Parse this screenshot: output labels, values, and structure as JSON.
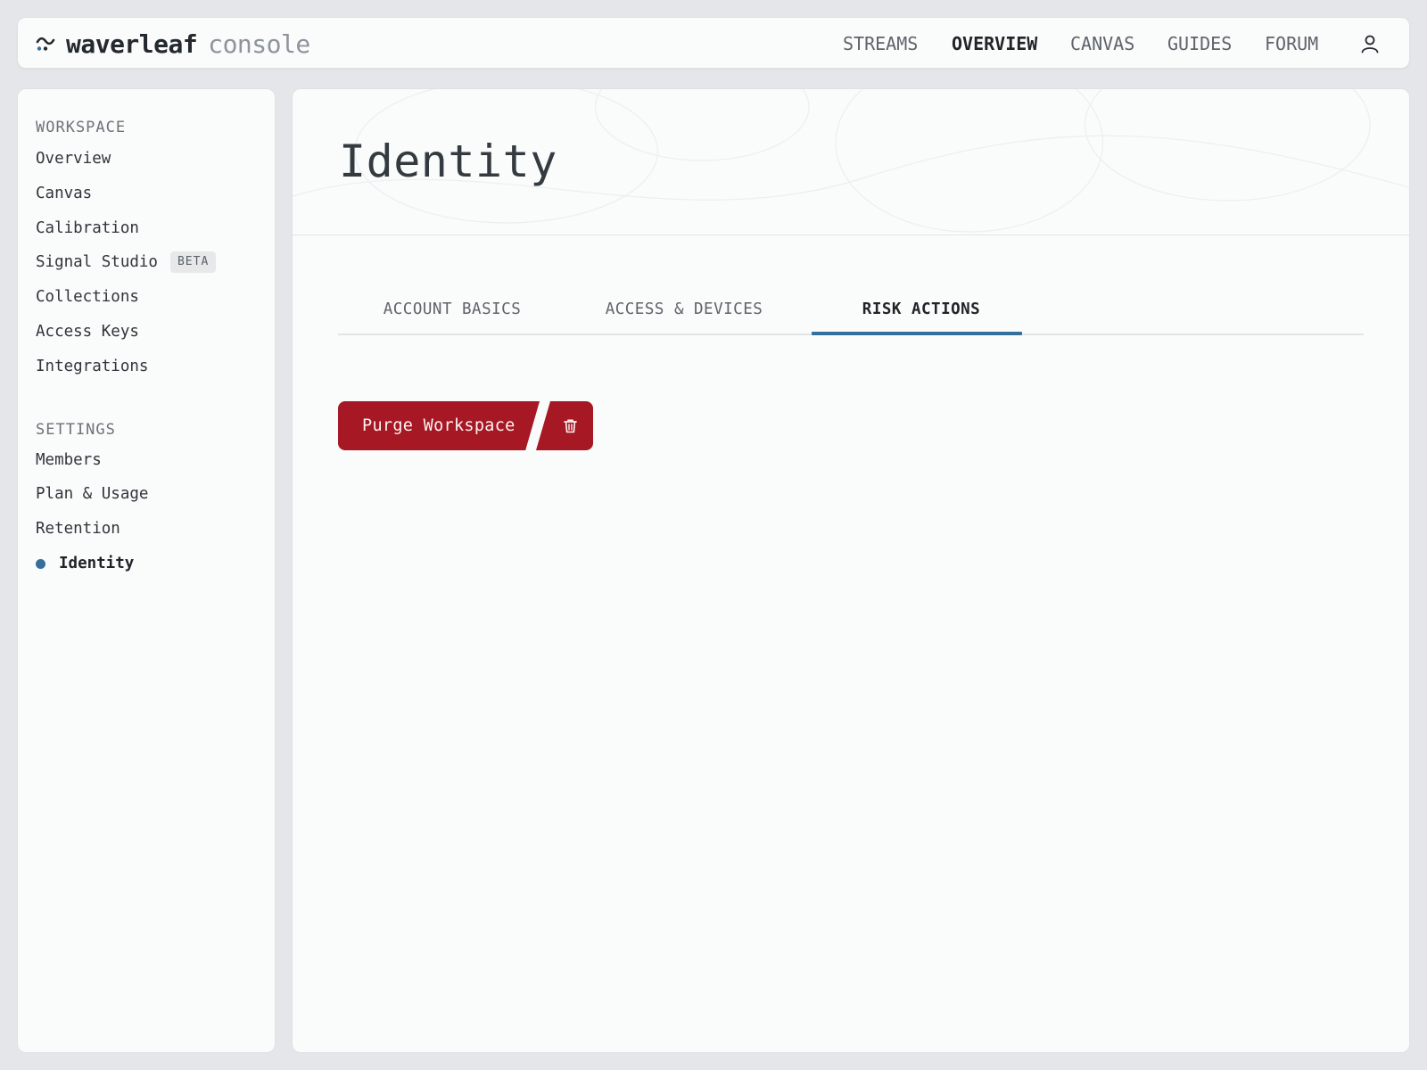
{
  "brand": {
    "name": "waverleaf",
    "sub": "console",
    "icon": "wave-logo-icon"
  },
  "topnav": {
    "items": [
      {
        "label": "STREAMS",
        "active": false
      },
      {
        "label": "OVERVIEW",
        "active": true
      },
      {
        "label": "CANVAS",
        "active": false
      },
      {
        "label": "GUIDES",
        "active": false
      },
      {
        "label": "FORUM",
        "active": false
      }
    ],
    "user_icon": "user-icon"
  },
  "sidebar": {
    "workspace_heading": "WORKSPACE",
    "workspace_items": [
      {
        "label": "Overview"
      },
      {
        "label": "Canvas"
      },
      {
        "label": "Calibration"
      },
      {
        "label": "Signal Studio",
        "badge": "BETA"
      },
      {
        "label": "Collections"
      },
      {
        "label": "Access Keys"
      },
      {
        "label": "Integrations"
      }
    ],
    "settings_heading": "SETTINGS",
    "settings_items": [
      {
        "label": "Members"
      },
      {
        "label": "Plan & Usage"
      },
      {
        "label": "Retention"
      },
      {
        "label": "Identity",
        "active": true
      }
    ]
  },
  "main": {
    "title": "Identity",
    "tabs": [
      {
        "label": "ACCOUNT BASICS",
        "active": false
      },
      {
        "label": "ACCESS & DEVICES",
        "active": false
      },
      {
        "label": "RISK ACTIONS",
        "active": true
      }
    ],
    "danger_button": {
      "label": "Purge Workspace",
      "icon": "trash-icon"
    }
  },
  "colors": {
    "accent": "#34709b",
    "danger": "#a51824",
    "background": "#e4e6e9",
    "panel": "#fafbfb"
  }
}
